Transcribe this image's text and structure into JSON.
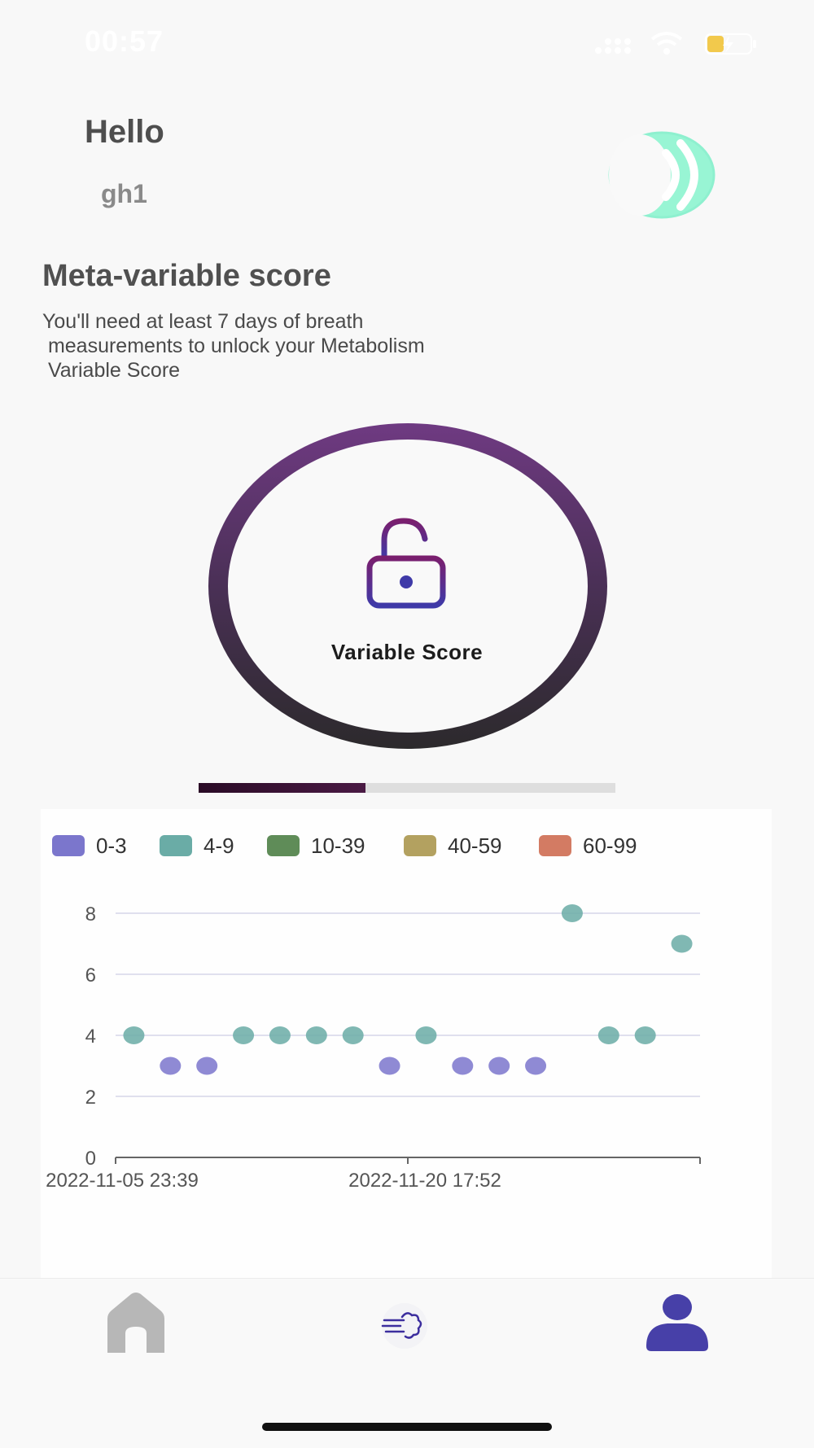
{
  "status_bar": {
    "time": "00:57"
  },
  "header": {
    "greeting": "Hello",
    "username": "gh1"
  },
  "score_section": {
    "title": "Meta-variable score",
    "description_lines": [
      "You'll need at least 7 days of breath",
      " measurements to unlock your Metabolism",
      " Variable Score"
    ],
    "score_label": "Variable Score",
    "progress": 0.4
  },
  "chart_data": {
    "type": "scatter",
    "legend": [
      {
        "label": "0-3",
        "color": "#7b76cc"
      },
      {
        "label": "4-9",
        "color": "#6aaca6"
      },
      {
        "label": "10-39",
        "color": "#5f8c58"
      },
      {
        "label": "40-59",
        "color": "#b3a160"
      },
      {
        "label": "60-99",
        "color": "#d37b63"
      }
    ],
    "x_tick_labels": [
      "2022-11-05 23:39",
      "2022-11-20 17:52"
    ],
    "y_ticks": [
      0,
      2,
      4,
      6,
      8
    ],
    "ylim": [
      0,
      8
    ],
    "points": [
      4,
      3,
      3,
      4,
      4,
      4,
      4,
      3,
      4,
      3,
      3,
      3,
      8,
      4,
      4,
      7
    ],
    "grid": true
  },
  "nav": {
    "items": [
      "home-icon",
      "breath-icon",
      "profile-icon"
    ],
    "active": "profile-icon"
  }
}
